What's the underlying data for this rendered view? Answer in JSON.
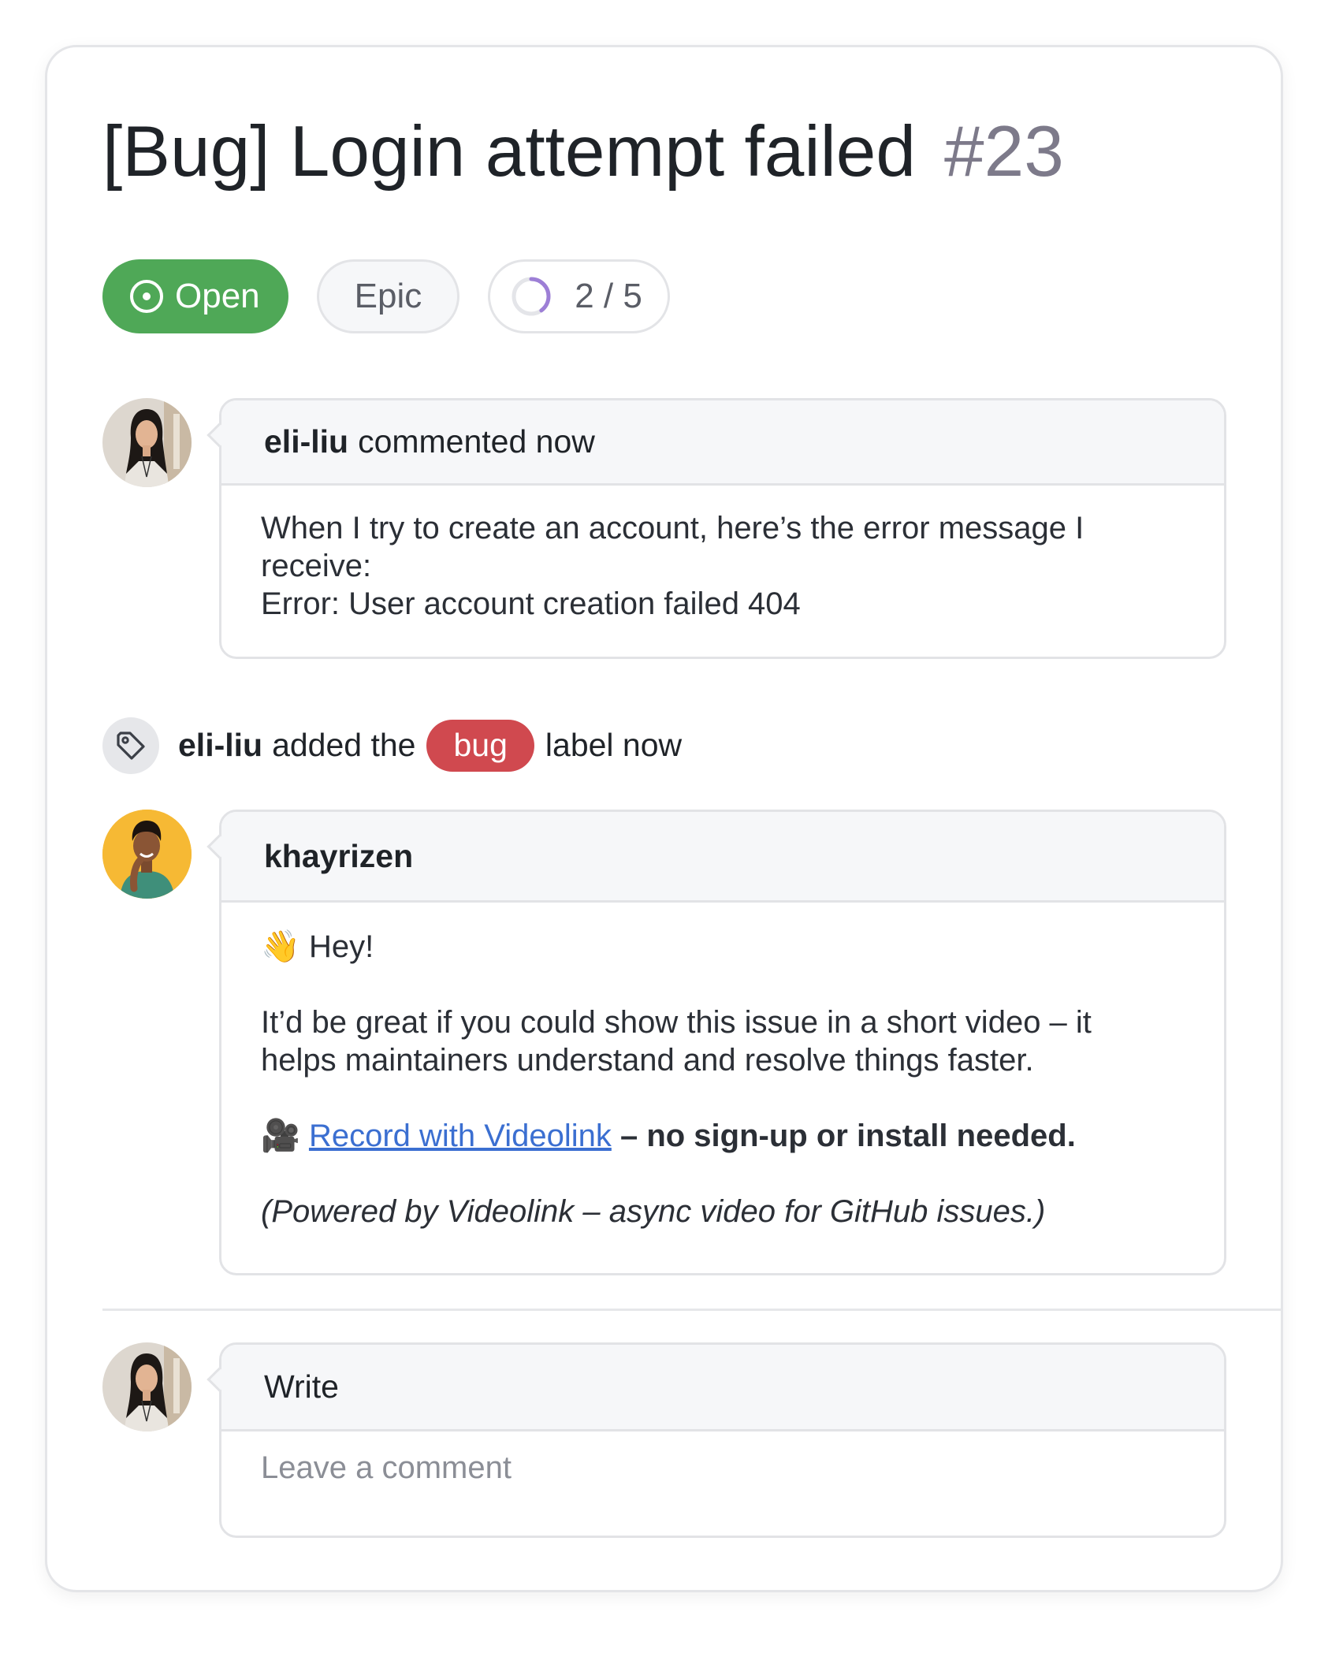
{
  "issue": {
    "title": "[Bug] Login attempt failed",
    "number": "#23"
  },
  "status_pills": {
    "open_label": "Open",
    "epic_label": "Epic",
    "progress_label": "2 / 5",
    "progress_fraction": 0.4,
    "open_color": "#4fa857",
    "progress_color": "#9d7fd6"
  },
  "comments": [
    {
      "author": "eli-liu",
      "action": "commented now",
      "body_lines": [
        "When I try to create an account, here’s the error message I",
        "receive:",
        "Error: User account creation failed 404"
      ]
    },
    {
      "author": "khayrizen",
      "greeting_icon": "👋",
      "greeting": "Hey!",
      "para1_line1": "It’d be great if you could show this issue in a short video – it",
      "para1_line2": "helps maintainers understand and resolve things faster.",
      "camera_icon": "🎥",
      "link_text": "Record with Videolink",
      "link_suffix": "– no sign-up or install needed.",
      "footer": "(Powered by Videolink – async video for GitHub issues.)"
    }
  ],
  "label_event": {
    "author": "eli-liu",
    "prefix": "added the",
    "label": "bug",
    "suffix": "label now",
    "label_color": "#d0494f"
  },
  "composer": {
    "tab_label": "Write",
    "placeholder": "Leave a comment"
  }
}
